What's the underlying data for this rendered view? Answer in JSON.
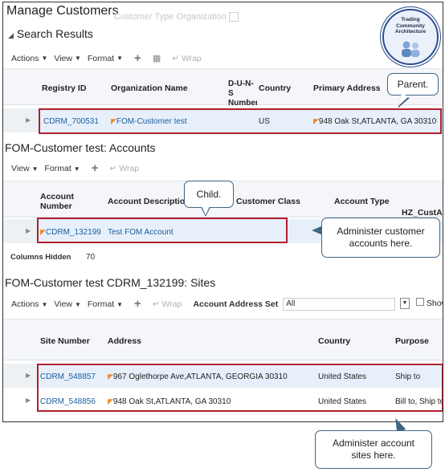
{
  "page_title": "Manage Customers",
  "ghost_label": "Customer Type  Organization",
  "search_results": {
    "title": "Search Results",
    "toolbar": {
      "actions": "Actions",
      "view": "View",
      "format": "Format",
      "wrap": "Wrap"
    },
    "columns": [
      "Registry ID",
      "Organization Name",
      "D-U-N-S Number",
      "Country",
      "Primary Address"
    ],
    "row": {
      "registry_id": "CDRM_700531",
      "org_name": "FOM-Customer test",
      "country": "US",
      "address": "948 Oak St,ATLANTA, GA 30310"
    }
  },
  "accounts": {
    "title": "FOM-Customer test: Accounts",
    "toolbar": {
      "view": "View",
      "format": "Format",
      "wrap": "Wrap"
    },
    "columns": [
      "Account Number",
      "Account Description",
      "Customer Class",
      "Account Type",
      "HZ_CustAc"
    ],
    "row": {
      "account_number": "CDRM_132199",
      "account_description": "Test FOM Account"
    },
    "columns_hidden_label": "Columns Hidden",
    "columns_hidden_value": "70"
  },
  "sites": {
    "title": "FOM-Customer test CDRM_132199: Sites",
    "toolbar": {
      "actions": "Actions",
      "view": "View",
      "format": "Format",
      "wrap": "Wrap",
      "account_address_set_label": "Account Address Set",
      "account_address_set_value": "All",
      "show": "Show"
    },
    "columns": [
      "Site Number",
      "Address",
      "Country",
      "Purpose"
    ],
    "rows": [
      {
        "site_number": "CDRM_548857",
        "address": "967 Oglethorpe Ave,ATLANTA, GEORGIA 30310",
        "country": "United States",
        "purpose": "Ship to"
      },
      {
        "site_number": "CDRM_548856",
        "address": "948 Oak St,ATLANTA, GA 30310",
        "country": "United States",
        "purpose": "Bill to, Ship to"
      }
    ]
  },
  "callouts": {
    "parent": "Parent.",
    "child": "Child.",
    "administer_accounts": "Administer customer accounts here.",
    "administer_sites": "Administer account sites here."
  },
  "badge": {
    "line1": "Trading",
    "line2": "Community",
    "line3": "Architecture"
  },
  "colors": {
    "link": "#1a5c9e",
    "highlight_box": "#b01e2e",
    "callout_border": "#3d6588",
    "selected_row": "#e7f0fa",
    "flag": "#f08a2c"
  }
}
